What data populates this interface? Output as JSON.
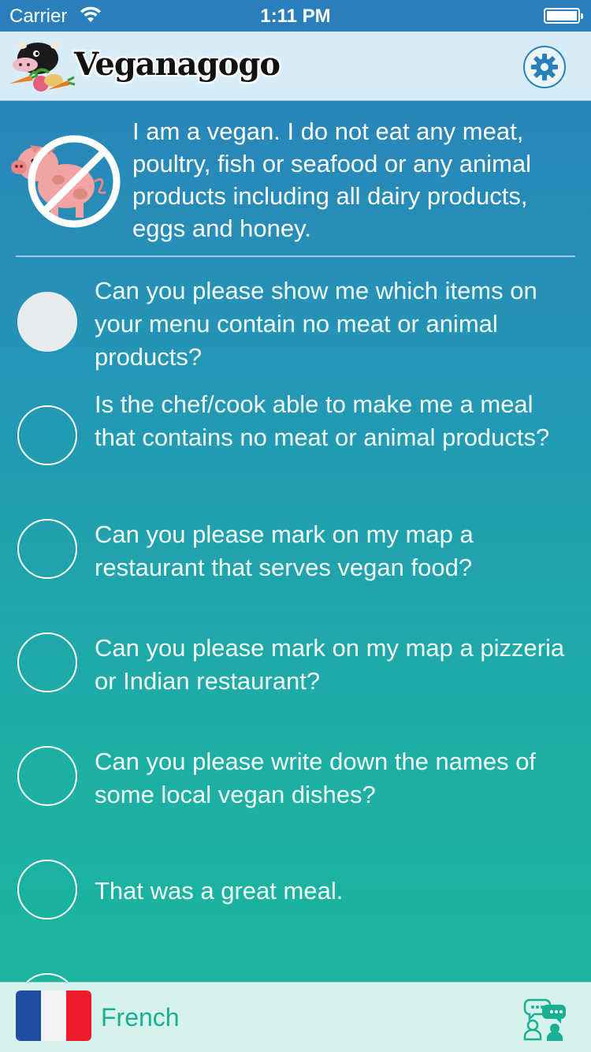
{
  "status_bar": {
    "carrier": "Carrier",
    "time": "1:11 PM",
    "battery_level": 1.0
  },
  "header": {
    "logo_text": "Veganagogo",
    "settings_icon": "gear-icon"
  },
  "intro": {
    "icon": "no-pig-icon",
    "text": "I am a vegan. I do not eat any meat, poultry, fish or seafood or any animal products including all dairy products, eggs and honey."
  },
  "phrases": [
    {
      "text": "Can you please show me which items on your menu contain no meat or animal products?",
      "selected": true
    },
    {
      "text": "Is the chef/cook able to make me a meal that contains no meat or animal products?",
      "selected": false
    },
    {
      "text": "Can you please mark on my map a restaurant that serves vegan food?",
      "selected": false
    },
    {
      "text": "Can you please mark on my map a pizzeria or Indian restaurant?",
      "selected": false
    },
    {
      "text": "Can you please write down the names of some local vegan dishes?",
      "selected": false
    },
    {
      "text": "That was a great meal.",
      "selected": false
    }
  ],
  "bottom_bar": {
    "language": "French",
    "flag_icon": "french-flag-icon",
    "chat_icon": "conversation-icon"
  },
  "colors": {
    "accent": "#2a7fbb",
    "teal": "#1aaf92",
    "gradient_top": "#2a7fb9",
    "gradient_bottom": "#1bb69c"
  }
}
